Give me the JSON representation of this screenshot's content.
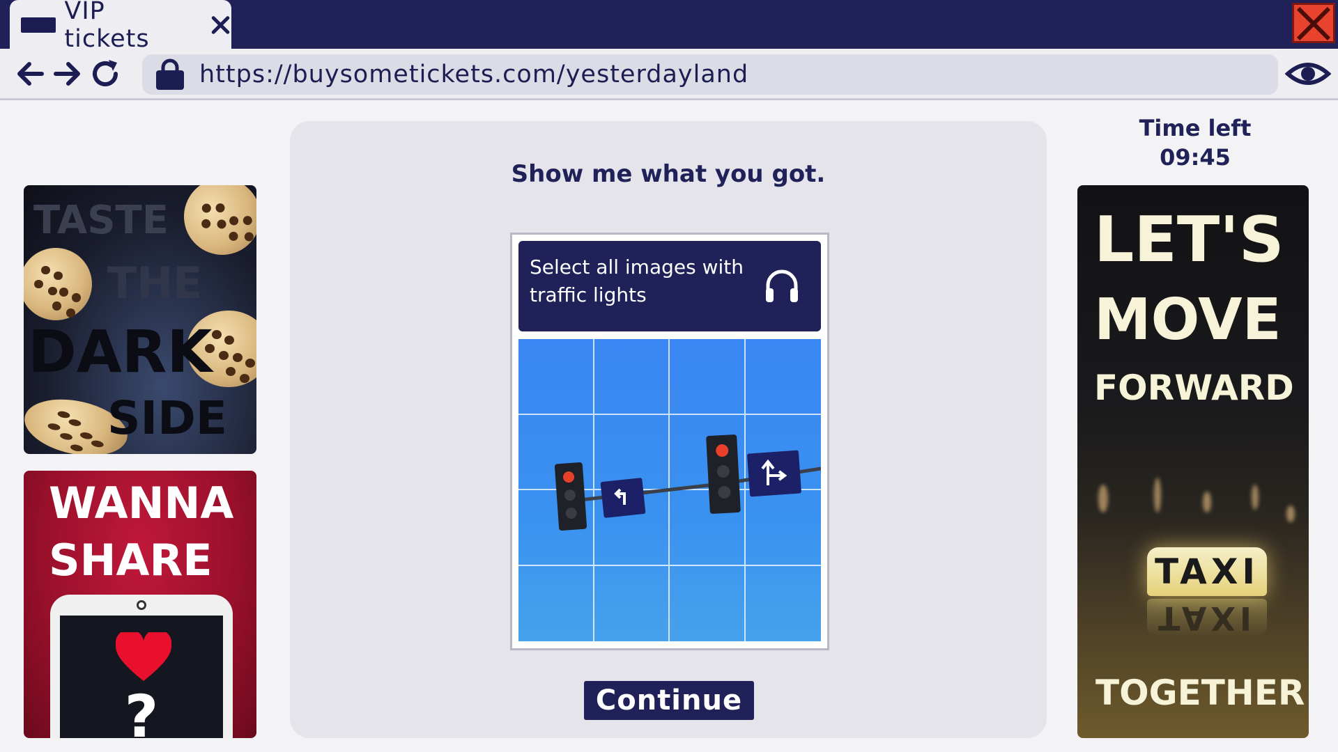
{
  "browser": {
    "tab_title": "VIP tickets",
    "url": "https://buysometickets.com/yesterdayland"
  },
  "icons": {
    "window_close": "close-icon",
    "tab_close": "close-icon",
    "back": "arrow-left-icon",
    "forward": "arrow-right-icon",
    "reload": "reload-icon",
    "lock": "lock-icon",
    "eye": "eye-icon",
    "audio": "headphones-icon"
  },
  "timer": {
    "label": "Time left",
    "value": "09:45"
  },
  "main": {
    "prompt": "Show me what you got.",
    "captcha": {
      "instruction": "Select all images with traffic lights",
      "grid_rows": 4,
      "grid_cols": 4
    },
    "continue_label": "Continue"
  },
  "ads": {
    "left_top": {
      "lines": [
        "TASTE",
        "THE",
        "DARK",
        "SIDE"
      ]
    },
    "left_bottom": {
      "lines": [
        "WANNA",
        "SHARE"
      ],
      "screen_text": "?"
    },
    "right": {
      "lines": [
        "LET'S",
        "MOVE",
        "FORWARD",
        "TOGETHER"
      ],
      "sign_text": "TAXI"
    }
  },
  "colors": {
    "navy": "#1f2158",
    "window_close": "#e8432f",
    "sky": "#3a8cf0"
  }
}
